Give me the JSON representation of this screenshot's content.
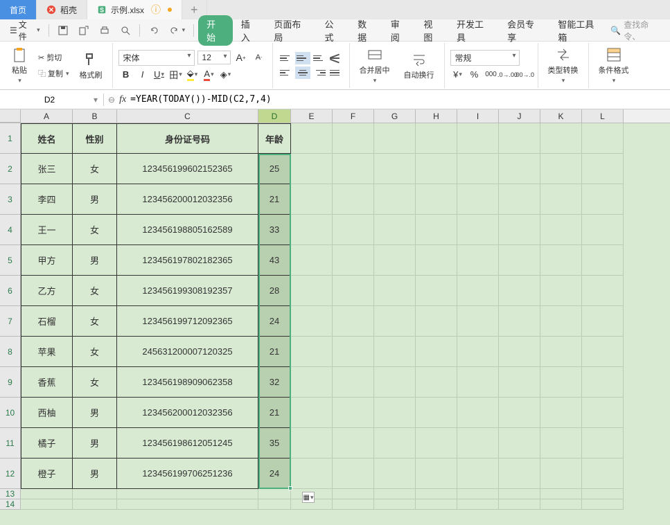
{
  "tabs": {
    "home": "首页",
    "daoke": "稻壳",
    "file": "示例.xlsx",
    "plus": "+"
  },
  "menu": {
    "file": "文件",
    "items": [
      "开始",
      "插入",
      "页面布局",
      "公式",
      "数据",
      "审阅",
      "视图",
      "开发工具",
      "会员专享",
      "智能工具箱"
    ],
    "search_ph": "查找命令、"
  },
  "ribbon": {
    "paste": "粘贴",
    "cut": "剪切",
    "copy": "复制",
    "format_painter": "格式刷",
    "font": "宋体",
    "size": "12",
    "merge": "合并居中",
    "wrap": "自动换行",
    "numfmt": "常规",
    "typeconv": "类型转换",
    "condfmt": "条件格式"
  },
  "namebox": "D2",
  "formula": "=YEAR(TODAY())-MID(C2,7,4)",
  "cols": [
    "A",
    "B",
    "C",
    "D",
    "E",
    "F",
    "G",
    "H",
    "I",
    "J",
    "K",
    "L"
  ],
  "headers": {
    "A": "姓名",
    "B": "性别",
    "C": "身份证号码",
    "D": "年龄"
  },
  "rows": [
    {
      "n": "张三",
      "s": "女",
      "id": "123456199602152365",
      "a": "25"
    },
    {
      "n": "李四",
      "s": "男",
      "id": "123456200012032356",
      "a": "21"
    },
    {
      "n": "王一",
      "s": "女",
      "id": "123456198805162589",
      "a": "33"
    },
    {
      "n": "甲方",
      "s": "男",
      "id": "123456197802182365",
      "a": "43"
    },
    {
      "n": "乙方",
      "s": "女",
      "id": "123456199308192357",
      "a": "28"
    },
    {
      "n": "石榴",
      "s": "女",
      "id": "123456199712092365",
      "a": "24"
    },
    {
      "n": "苹果",
      "s": "女",
      "id": "245631200007120325",
      "a": "21"
    },
    {
      "n": "香蕉",
      "s": "女",
      "id": "123456198909062358",
      "a": "32"
    },
    {
      "n": "西柚",
      "s": "男",
      "id": "123456200012032356",
      "a": "21"
    },
    {
      "n": "橘子",
      "s": "男",
      "id": "123456198612051245",
      "a": "35"
    },
    {
      "n": "橙子",
      "s": "男",
      "id": "123456199706251236",
      "a": "24"
    }
  ],
  "percent": "%"
}
